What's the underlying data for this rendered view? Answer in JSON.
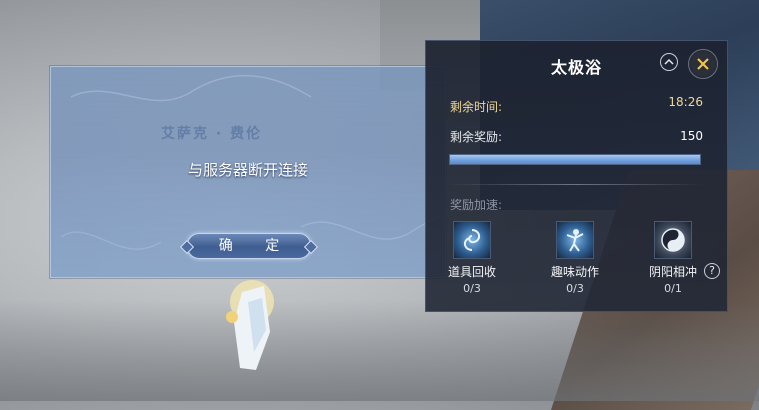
{
  "dialog": {
    "background_name": "艾萨克 · 费伦",
    "message": "与服务器断开连接",
    "confirm_label": "确 定"
  },
  "panel": {
    "title": "太极浴",
    "time_label": "剩余时间:",
    "time_value": "18:26",
    "reward_label": "剩余奖励:",
    "reward_value": "150",
    "reward_progress_fraction": 1.0,
    "speed_label": "奖励加速:",
    "skills": [
      {
        "name": "道具回收",
        "count": "0/3",
        "icon": "vortex-icon"
      },
      {
        "name": "趣味动作",
        "count": "0/3",
        "icon": "dance-icon"
      },
      {
        "name": "阴阳相冲",
        "count": "0/1",
        "icon": "yin-yang-icon"
      }
    ],
    "help": "?"
  },
  "colors": {
    "time_gold": "#f1d79a",
    "progress_blue": "#6f9edc"
  }
}
